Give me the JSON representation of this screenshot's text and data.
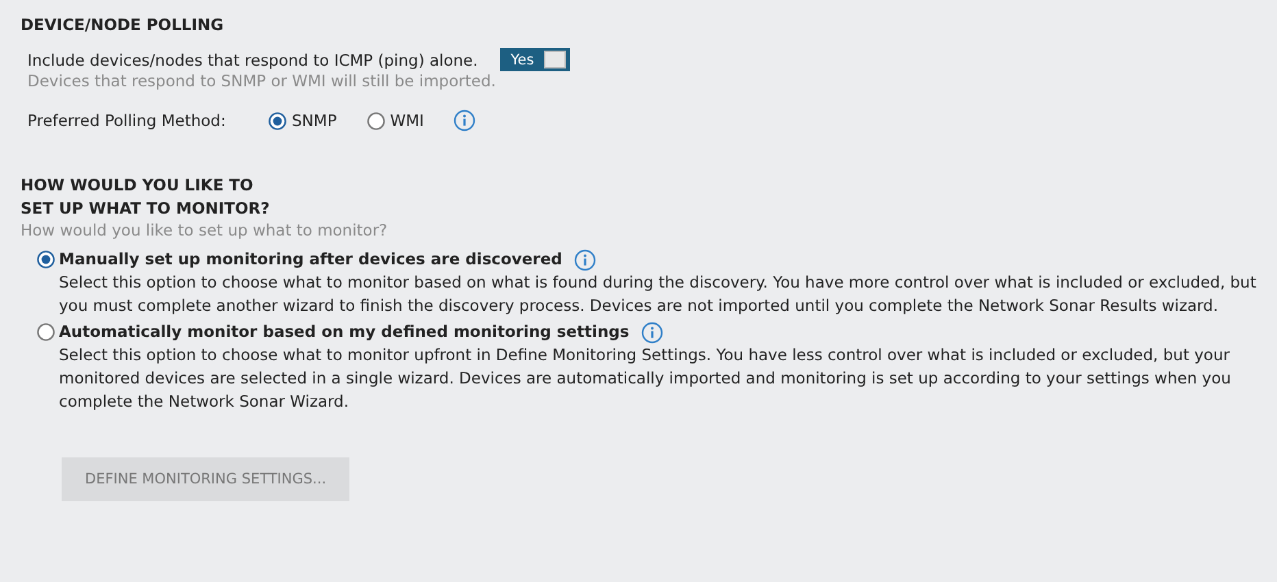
{
  "polling": {
    "title": "DEVICE/NODE POLLING",
    "icmp": {
      "label": "Include devices/nodes that respond to ICMP (ping) alone.",
      "toggle": {
        "label": "Yes",
        "on": true
      },
      "hint": "Devices that respond to SNMP or WMI will still be imported."
    },
    "method": {
      "label": "Preferred Polling Method:",
      "options": [
        {
          "label": "SNMP",
          "selected": true
        },
        {
          "label": "WMI",
          "selected": false
        }
      ]
    }
  },
  "monitor": {
    "title": "HOW WOULD YOU LIKE TO\nSET UP WHAT TO MONITOR?",
    "subtitle": "How would you like to set up what to monitor?",
    "options": [
      {
        "label": "Manually set up monitoring after devices are discovered",
        "selected": true,
        "description": "Select this option to choose what to monitor based on what is found during the discovery. You have more control over what is included or excluded, but you must complete another wizard to finish the discovery process. Devices are not imported until you complete the Network Sonar Results wizard."
      },
      {
        "label": "Automatically monitor based on my defined monitoring settings",
        "selected": false,
        "description": "Select this option to choose what to monitor upfront in Define Monitoring Settings. You have less control over what is included or excluded, but your monitored devices are selected in a single wizard. Devices are automatically imported and monitoring is set up according to your settings when you complete the Network Sonar Wizard."
      }
    ],
    "button": {
      "label": "DEFINE MONITORING SETTINGS...",
      "disabled": true
    }
  }
}
